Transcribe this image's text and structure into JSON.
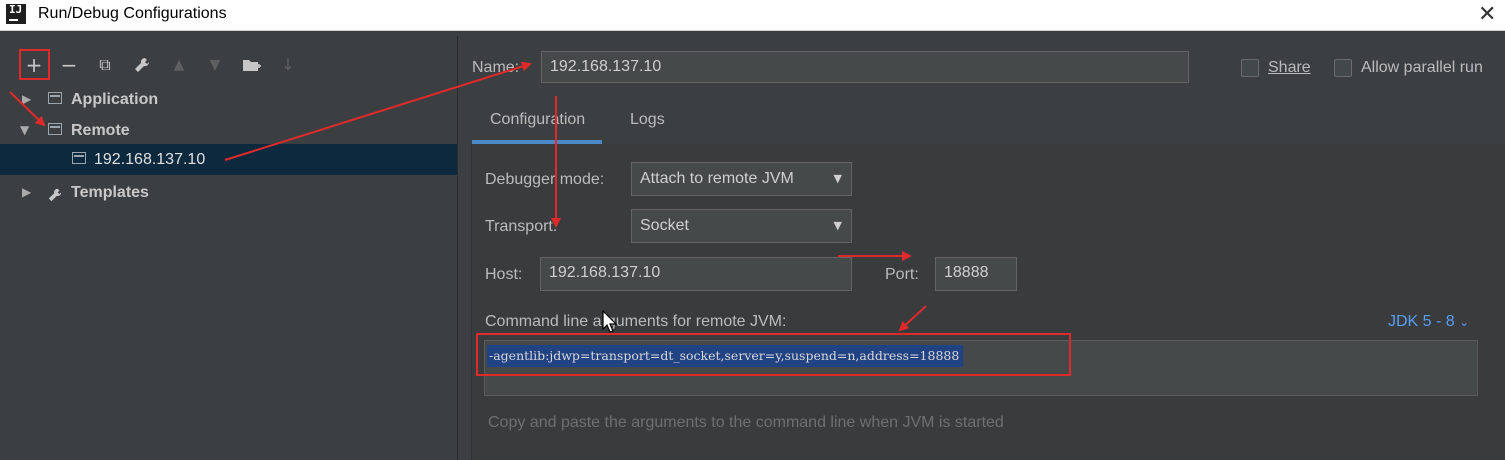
{
  "window": {
    "title": "Run/Debug Configurations",
    "app_icon_text": "IJ"
  },
  "toolbar": {
    "add": "+",
    "remove": "−",
    "copy": "⧉",
    "wrench": "🔧",
    "move_up": "▲",
    "move_down": "▼",
    "folder": "▣",
    "sort": "↓"
  },
  "tree": {
    "items": [
      {
        "label": "Application"
      },
      {
        "label": "Remote"
      },
      {
        "label": "192.168.137.10"
      },
      {
        "label": "Templates"
      }
    ]
  },
  "name": {
    "label": "Name:",
    "value": "192.168.137.10"
  },
  "share": {
    "label": "Share",
    "checked": false
  },
  "parallel": {
    "label": "Allow parallel run",
    "checked": false
  },
  "tabs": [
    {
      "label": "Configuration"
    },
    {
      "label": "Logs"
    }
  ],
  "debugger": {
    "label": "Debugger mode:",
    "value": "Attach to remote JVM"
  },
  "transport": {
    "label": "Transport:",
    "value": "Socket"
  },
  "host": {
    "label": "Host:",
    "value": "192.168.137.10"
  },
  "port": {
    "label": "Port:",
    "value": "18888"
  },
  "cmdline": {
    "label": "Command line arguments for remote JVM:",
    "value": "-agentlib:jdwp=transport=dt_socket,server=y,suspend=n,address=18888",
    "jdk": "JDK 5 - 8",
    "hint": "Copy and paste the arguments to the command line when JVM is started"
  },
  "colors": {
    "accent": "#4a88c7",
    "annotation": "#e02a2a",
    "selection": "#214283"
  }
}
